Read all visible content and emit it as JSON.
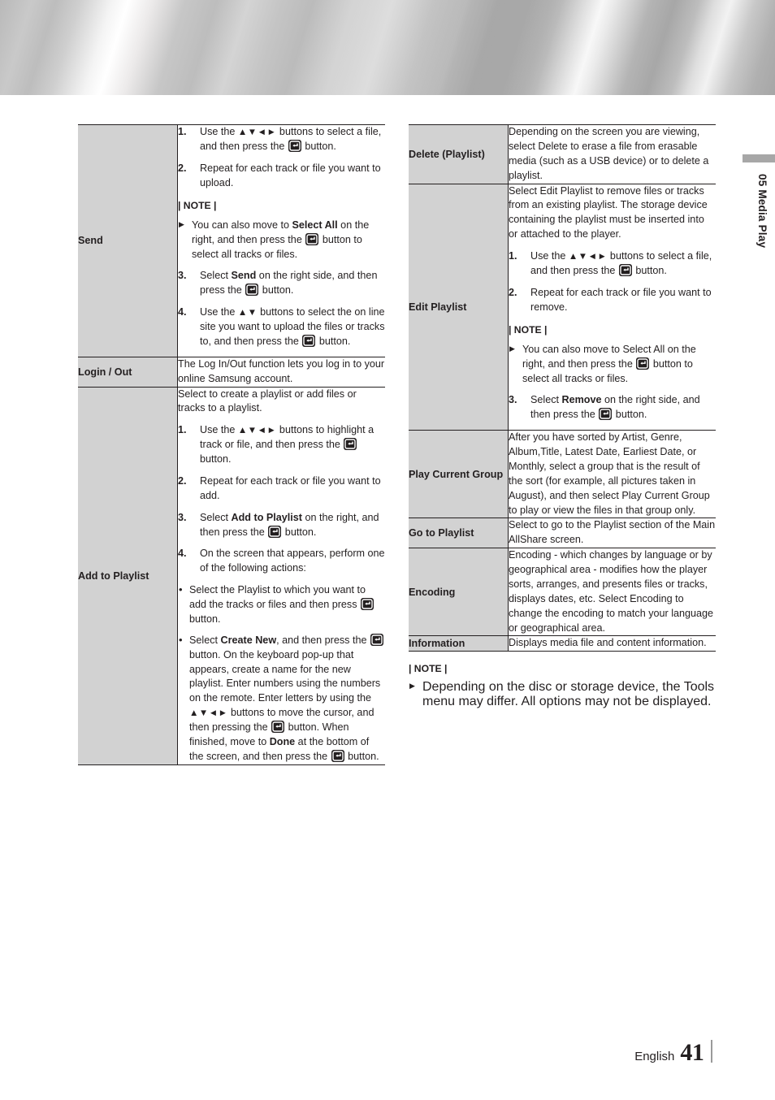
{
  "page": {
    "chapter_number": "05",
    "chapter_title": "Media Play",
    "footer_language": "English",
    "footer_page": "41"
  },
  "icons": {
    "enter_button": "enter-button-icon",
    "arrows_4": "▲▼◄►",
    "arrows_2": "▲▼",
    "note_triangle": "▶",
    "bullet_dot": "•"
  },
  "left_table": {
    "rows": [
      {
        "label": "Send",
        "steps_1": [
          {
            "n": "1.",
            "pre": "Use the ",
            "arrows": "▲▼◄►",
            "mid": " buttons to select a file, and then press the ",
            "post": " button."
          },
          {
            "n": "2.",
            "pre": "Repeat for each track or file you want to upload.",
            "arrows": "",
            "mid": "",
            "post": ""
          }
        ],
        "note_heading": "| NOTE |",
        "notes": [
          {
            "pre": "You can also move to ",
            "bold": "Select All",
            "mid": " on the right, and then press the ",
            "post": " button to select all tracks or files."
          }
        ],
        "steps_2": [
          {
            "n": "3.",
            "pre": "Select ",
            "bold": "Send",
            "mid": " on the right side, and then press the ",
            "post": " button."
          },
          {
            "n": "4.",
            "pre": "Use the ",
            "arrows": "▲▼",
            "mid": " buttons to select the on line site you want to upload the files or tracks to, and then press the ",
            "post": " button."
          }
        ]
      },
      {
        "label": "Login / Out",
        "text": "The Log In/Out function lets you log in to your online Samsung account."
      },
      {
        "label": "Add to Playlist",
        "intro": "Select to create a playlist or add files or tracks to a playlist.",
        "steps": [
          {
            "n": "1.",
            "pre": "Use the ",
            "arrows": "▲▼◄►",
            "mid": " buttons to highlight a track or file, and then press the ",
            "post": " button."
          },
          {
            "n": "2.",
            "pre": "Repeat for each track or file you want to add."
          },
          {
            "n": "3.",
            "pre": "Select ",
            "bold": "Add to Playlist",
            "mid": " on the right, and then press the ",
            "post": " button."
          },
          {
            "n": "4.",
            "pre": "On the screen that appears, perform one of the following actions:"
          }
        ],
        "bullets": [
          {
            "pre": "Select the Playlist to which you want to add the tracks or files and then press ",
            "post": " button."
          },
          {
            "pre": "Select ",
            "bold": "Create New",
            "mid": ", and then press the ",
            "mid2": " button. On the keyboard pop-up that appears, create a name for the new playlist. Enter numbers using the numbers on the remote. Enter letters by using the ",
            "arrows": "▲▼◄►",
            "mid3": " buttons to move the cursor, and then pressing the ",
            "mid4": " button. When finished, move to ",
            "bold2": "Done",
            "mid5": " at the bottom of the screen, and then press the ",
            "post": " button."
          }
        ]
      }
    ]
  },
  "right_table": {
    "rows": [
      {
        "label": "Delete (Playlist)",
        "text": "Depending on the screen you are viewing, select Delete to erase a file from erasable media (such as a USB device) or to delete a playlist."
      },
      {
        "label": "Edit Playlist",
        "intro": "Select Edit Playlist to remove files or tracks from an existing playlist. The storage device containing the playlist must be inserted into or attached to the player.",
        "steps_1": [
          {
            "n": "1.",
            "pre": "Use the ",
            "arrows": "▲▼◄►",
            "mid": " buttons to select a file, and then press the ",
            "post": " button."
          },
          {
            "n": "2.",
            "pre": "Repeat for each track or file you want to remove."
          }
        ],
        "note_heading": "| NOTE |",
        "notes": [
          {
            "pre": "You can also move to Select All on the right, and then press the ",
            "post": " button to select all tracks or files."
          }
        ],
        "steps_2": [
          {
            "n": "3.",
            "pre": "Select ",
            "bold": "Remove",
            "mid": " on the right side, and then press the ",
            "post": " button."
          }
        ]
      },
      {
        "label": "Play Current Group",
        "text": "After you have sorted by Artist, Genre, Album,Title, Latest Date, Earliest Date, or Monthly, select a group that is the result of the sort (for example, all pictures taken in August), and then select Play Current Group to play or view the files in that group only."
      },
      {
        "label": "Go to Playlist",
        "text": "Select to go to the Playlist section of the Main AllShare screen."
      },
      {
        "label": "Encoding",
        "text": "Encoding - which changes by language or by geographical area - modifies how the player sorts, arranges, and presents files or tracks, displays dates, etc. Select Encoding to change the encoding to match your language or geographical area."
      },
      {
        "label": "Information",
        "text": "Displays media file and content information."
      }
    ]
  },
  "bottom_note": {
    "heading": "| NOTE |",
    "items": [
      "Depending on the disc or storage device, the Tools menu may differ. All options may not be displayed."
    ]
  },
  "colors": {
    "label_cell_bg": "#d2d2d2",
    "border": "#231f20",
    "text": "#231f20",
    "chapter_mark": "#a7a7a7"
  }
}
